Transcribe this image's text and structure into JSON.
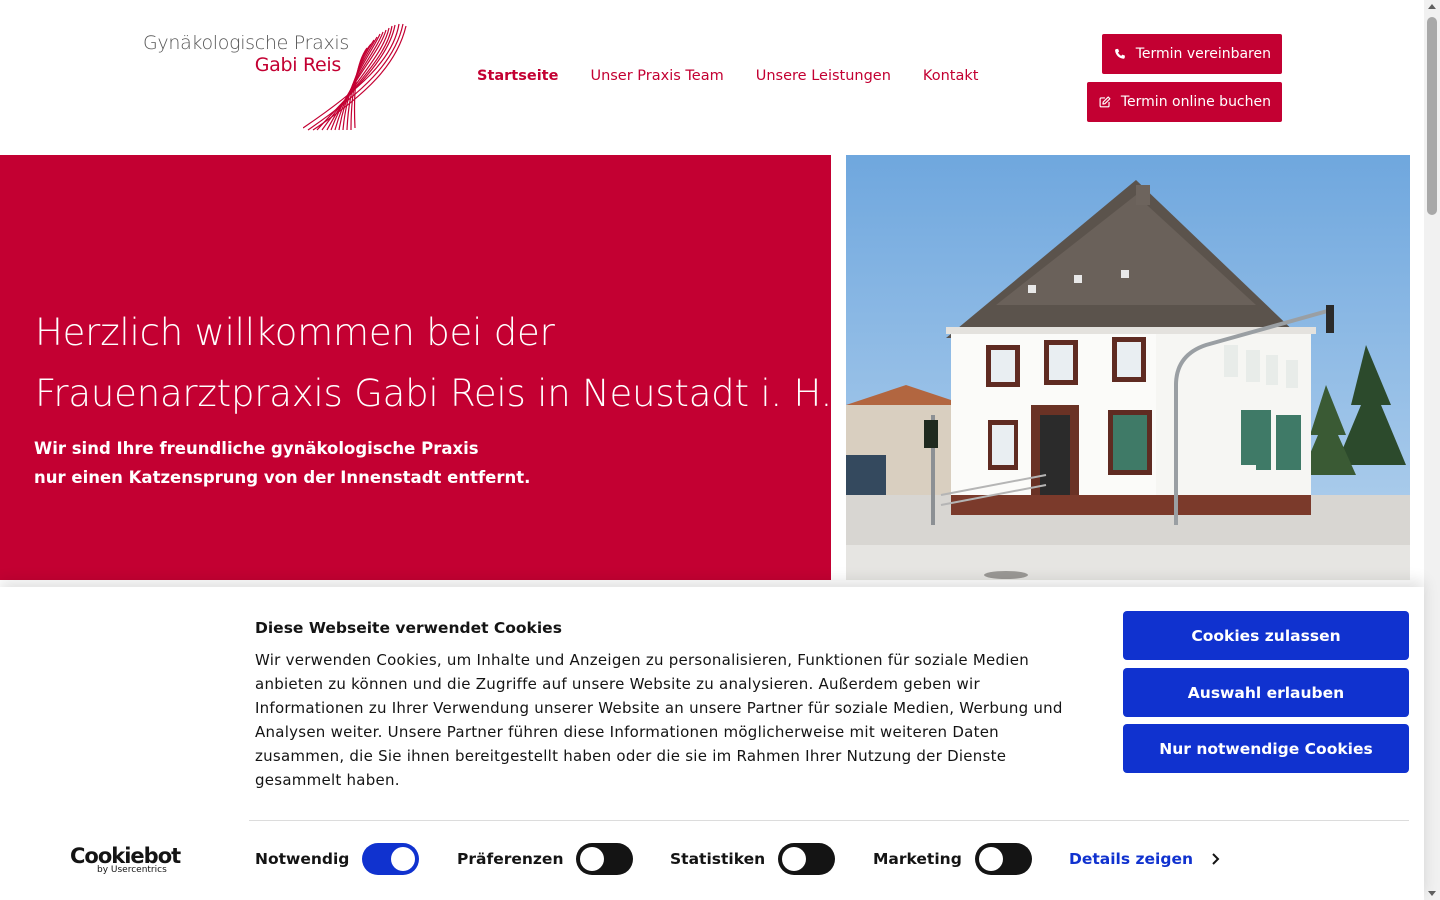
{
  "header": {
    "logo": {
      "line1": "Gynäkologische Praxis",
      "line2": "Gabi Reis",
      "accent_color": "#c30032"
    },
    "nav": [
      {
        "label": "Startseite",
        "active": true
      },
      {
        "label": "Unser Praxis Team",
        "active": false
      },
      {
        "label": "Unsere Leistungen",
        "active": false
      },
      {
        "label": "Kontakt",
        "active": false
      }
    ],
    "buttons": {
      "termin": {
        "label": "Termin vereinbaren",
        "icon": "phone-icon"
      },
      "online": {
        "label": "Termin online buchen",
        "icon": "edit-icon"
      }
    }
  },
  "hero": {
    "title_line1": "Herzlich willkommen bei der",
    "title_line2": "Frauenarztpraxis Gabi Reis in Neustadt i. H.",
    "sub_line1": "Wir sind Ihre freundliche gynäkologische Praxis",
    "sub_line2": "nur einen Katzensprung von der Innenstadt entfernt.",
    "bg_color": "#c30032"
  },
  "cookie_banner": {
    "title": "Diese Webseite verwendet Cookies",
    "text": "Wir verwenden Cookies, um Inhalte und Anzeigen zu personalisieren, Funktionen für soziale Medien anbieten zu können und die Zugriffe auf unsere Website zu analysieren. Außerdem geben wir Informationen zu Ihrer Verwendung unserer Website an unsere Partner für soziale Medien, Werbung und Analysen weiter. Unsere Partner führen diese Informationen möglicherweise mit weiteren Daten zusammen, die Sie ihnen bereitgestellt haben oder die sie im Rahmen Ihrer Nutzung der Dienste gesammelt haben.",
    "buttons": {
      "allow_all": "Cookies zulassen",
      "allow_selection": "Auswahl erlauben",
      "necessary_only": "Nur notwendige Cookies"
    },
    "toggles": [
      {
        "label": "Notwendig",
        "on": true
      },
      {
        "label": "Präferenzen",
        "on": false
      },
      {
        "label": "Statistiken",
        "on": false
      },
      {
        "label": "Marketing",
        "on": false
      }
    ],
    "details_label": "Details zeigen",
    "brand": {
      "name": "Cookiebot",
      "by": "by Usercentrics"
    },
    "button_color": "#1032cf"
  }
}
